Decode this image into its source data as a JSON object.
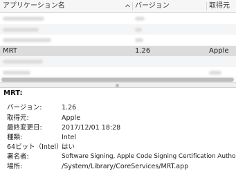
{
  "table": {
    "columns": {
      "name": "アプリケーション名",
      "version": "バージョン",
      "source": "取得元"
    },
    "selected_row": {
      "name": "MRT",
      "version": "1.26",
      "source": "Apple"
    }
  },
  "details": {
    "title": "MRT:",
    "fields": [
      {
        "label": "バージョン:",
        "value": "1.26"
      },
      {
        "label": "取得元:",
        "value": "Apple"
      },
      {
        "label": "最終変更日:",
        "value": "2017/12/01 18:28"
      },
      {
        "label": "種類:",
        "value": "Intel"
      },
      {
        "label": "64ビット（Intel）:",
        "value": "はい"
      },
      {
        "label": "署名者:",
        "value": "Software Signing, Apple Code Signing Certification Authority"
      },
      {
        "label": "場所:",
        "value": "/System/Library/CoreServices/MRT.app"
      }
    ]
  }
}
